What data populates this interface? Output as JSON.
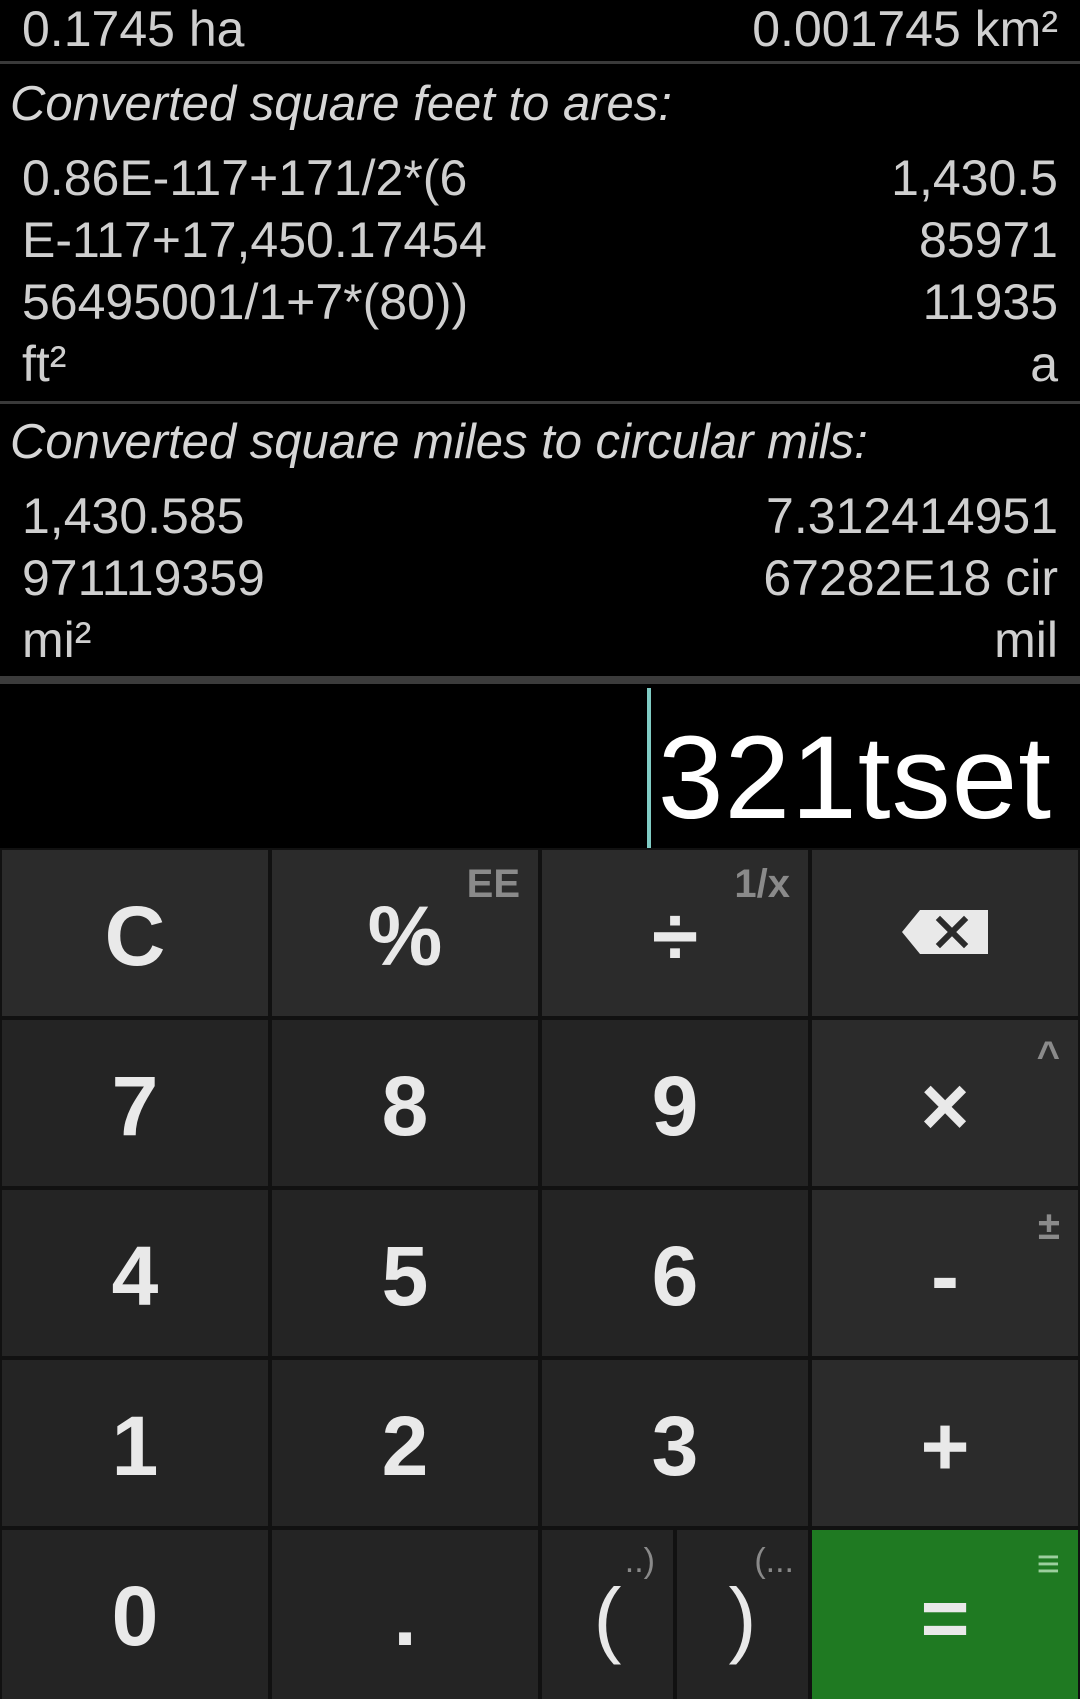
{
  "history": {
    "row0": {
      "left": "0.1745 ha",
      "right": "0.001745 km²"
    },
    "block1": {
      "title": "Converted square feet to ares:",
      "left_lines": [
        "0.86E-117+171/2*(6",
        "E-117+17,450.17454",
        "56495001/1+7*(80))",
        "ft²"
      ],
      "right_lines": [
        "1,430.5",
        "85971",
        "11935",
        "a"
      ]
    },
    "block2": {
      "title": "Converted square miles to circular mils:",
      "left_lines": [
        "1,430.585",
        "971119359",
        "mi²"
      ],
      "right_lines": [
        "7.312414951",
        "67282E18 cir",
        "mil"
      ]
    }
  },
  "display": {
    "value": "321tset"
  },
  "keys": {
    "clear": {
      "main": "C"
    },
    "percent": {
      "main": "%",
      "alt": "EE"
    },
    "divide": {
      "main": "÷",
      "alt": "1/x"
    },
    "backspace": {
      "icon": "backspace-icon"
    },
    "seven": {
      "main": "7"
    },
    "eight": {
      "main": "8"
    },
    "nine": {
      "main": "9"
    },
    "multiply": {
      "main": "×",
      "alt": "^"
    },
    "four": {
      "main": "4"
    },
    "five": {
      "main": "5"
    },
    "six": {
      "main": "6"
    },
    "minus": {
      "main": "-",
      "alt": "±"
    },
    "one": {
      "main": "1"
    },
    "two": {
      "main": "2"
    },
    "three": {
      "main": "3"
    },
    "plus": {
      "main": "+"
    },
    "zero": {
      "main": "0"
    },
    "dot": {
      "main": "."
    },
    "open_paren": {
      "main": "(",
      "alt": "..)"
    },
    "close_paren": {
      "main": ")",
      "alt": "(..."
    },
    "equals": {
      "main": "=",
      "alt": "≡"
    }
  },
  "colors": {
    "equals_bg": "#1f7a22",
    "caret": "#80cbc4",
    "key_bg": "#242424"
  }
}
